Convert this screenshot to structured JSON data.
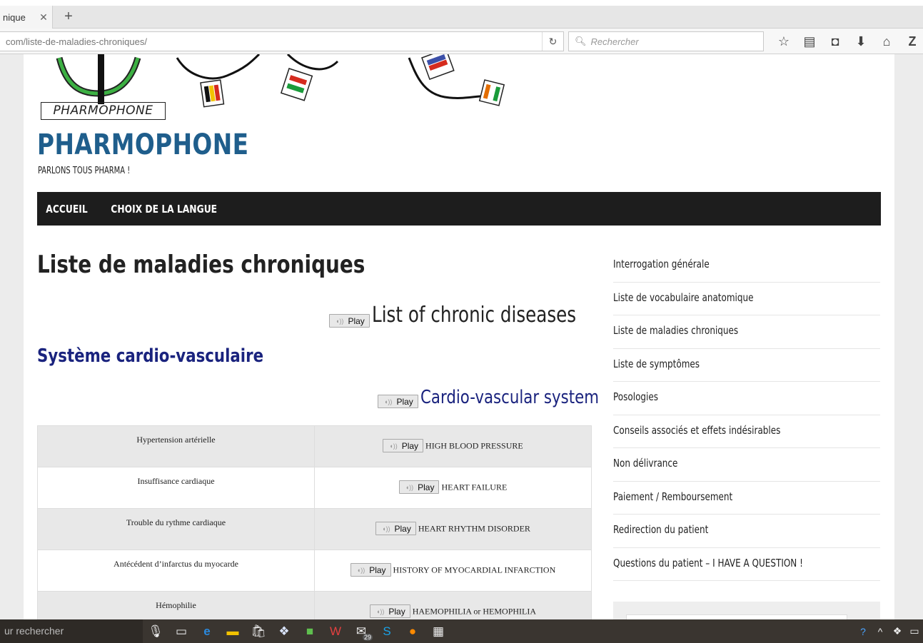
{
  "browser": {
    "tab_title": "nique",
    "url": "com/liste-de-maladies-chroniques/",
    "search_placeholder": "Rechercher"
  },
  "header": {
    "logo_text": "PHARMOPHONE",
    "site_title": "PHARMOPHONE",
    "tagline": "PARLONS TOUS PHARMA !"
  },
  "nav": {
    "items": [
      "ACCUEIL",
      "CHOIX DE LA LANGUE"
    ]
  },
  "article": {
    "title": "Liste de maladies chroniques",
    "title_en": "List of chronic diseases",
    "play_label": "Play",
    "section": "Système cardio-vasculaire",
    "section_en": "Cardio-vascular system",
    "rows": [
      {
        "fr": "Hypertension artérielle",
        "en": "HIGH BLOOD PRESSURE"
      },
      {
        "fr": "Insuffisance cardiaque",
        "en": "HEART FAILURE"
      },
      {
        "fr": "Trouble du rythme cardiaque",
        "en": "HEART RHYTHM DISORDER"
      },
      {
        "fr": "Antécédent d’infarctus du myocarde",
        "en": "HISTORY OF MYOCARDIAL INFARCTION"
      },
      {
        "fr": "Hémophilie",
        "en": "HAEMOPHILIA or HEMOPHILIA"
      }
    ]
  },
  "sidebar": {
    "items": [
      "Interrogation générale",
      "Liste de vocabulaire anatomique",
      "Liste de maladies chroniques",
      "Liste de symptômes",
      "Posologies",
      "Conseils associés et effets indésirables",
      "Non délivrance",
      "Paiement / Remboursement",
      "Redirection du patient",
      "Questions du patient – I HAVE A QUESTION !"
    ]
  },
  "taskbar": {
    "search_text": "ur rechercher",
    "mail_badge": "29"
  }
}
